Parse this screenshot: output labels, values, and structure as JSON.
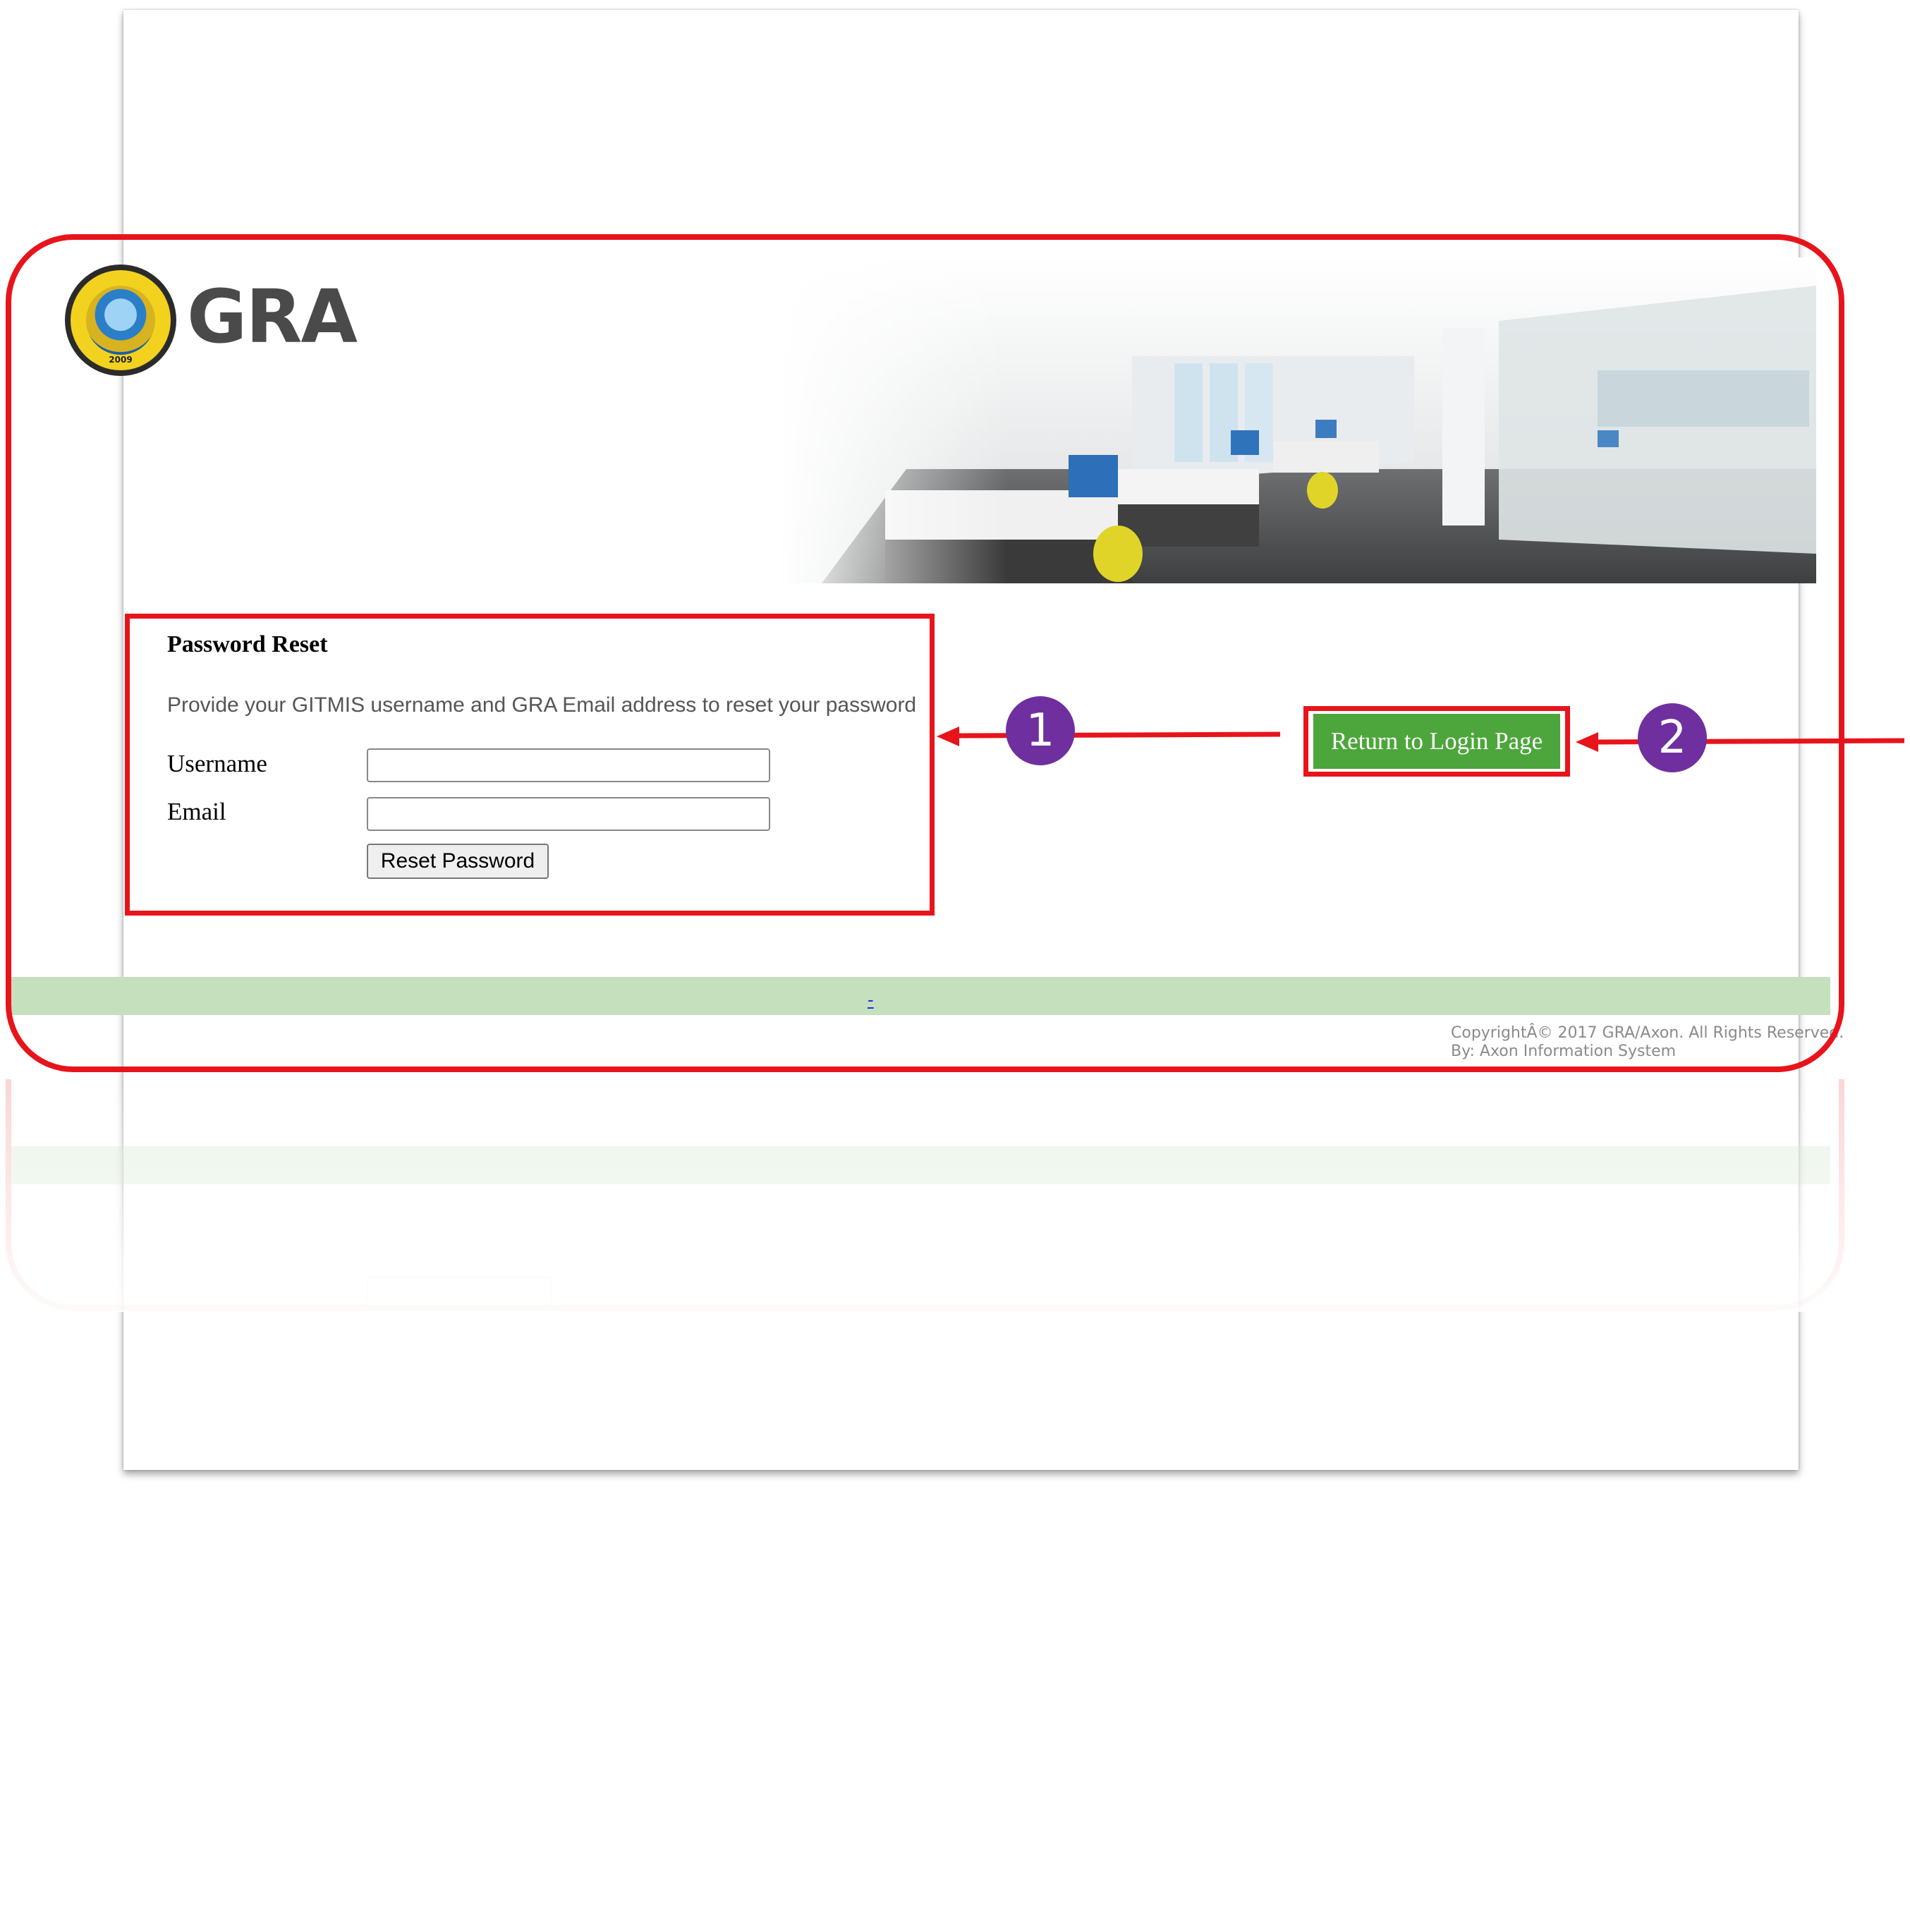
{
  "header": {
    "logo_text": "GRA",
    "seal_year": "2009"
  },
  "panel": {
    "title": "Password Reset",
    "description": "Provide your GITMIS username and GRA Email address to reset your password",
    "username_label": "Username",
    "username_value": "",
    "email_label": "Email",
    "email_value": "",
    "reset_button": "Reset Password"
  },
  "return_button": "Return to Login Page",
  "callouts": [
    "1",
    "2"
  ],
  "footer": {
    "link_text": "-",
    "copyright": "CopyrightÂ© 2017 GRA/Axon. All Rights Reserved.",
    "by_line": "By: Axon Information System"
  },
  "colors": {
    "annotation_red": "#e8141b",
    "callout_purple": "#6f2f9f",
    "button_green": "#4da63b",
    "footer_green": "#c4e0bd"
  }
}
